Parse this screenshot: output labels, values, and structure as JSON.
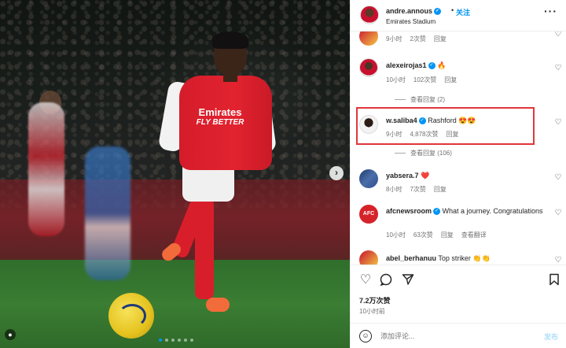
{
  "post": {
    "owner": "andre.annous",
    "follow_label": "关注",
    "separator": "•",
    "location": "Emirates Stadium",
    "more_icon": "more-horizontal-icon",
    "carousel_dots": 6,
    "active_dot": 0
  },
  "photo": {
    "sponsor_line1": "Emirates",
    "sponsor_line2": "FLY BETTER"
  },
  "comments": [
    {
      "user": "",
      "text": "",
      "time": "9小时",
      "likes": "2次赞",
      "reply": "回复"
    },
    {
      "user": "alexeirojas1",
      "verified": true,
      "text": "🔥",
      "time": "10小时",
      "likes": "102次赞",
      "reply": "回复",
      "view_replies": "查看回复 (2)"
    },
    {
      "user": "w.saliba4",
      "verified": true,
      "text": "Rashford 😍😍",
      "time": "9小时",
      "likes": "4,878次赞",
      "reply": "回复",
      "view_replies": "查看回复 (106)"
    },
    {
      "user": "yabsera.7",
      "verified": false,
      "text": "❤️",
      "time": "8小时",
      "likes": "7次赞",
      "reply": "回复"
    },
    {
      "user": "afcnewsroom",
      "verified": true,
      "text": "What a journey. Congratulations",
      "time": "10小时",
      "likes": "63次赞",
      "reply": "回复",
      "translate": "查看翻译",
      "avatar_text": "AFC"
    },
    {
      "user": "abel_berhanuu",
      "verified": false,
      "text": "Top striker 👏👏"
    }
  ],
  "actions": {
    "like_icon": "heart-icon",
    "comment_icon": "comment-icon",
    "share_icon": "share-icon",
    "save_icon": "bookmark-icon",
    "likes_count": "7.2万次赞",
    "time_ago": "10小时前"
  },
  "add_comment": {
    "placeholder": "添加评论...",
    "post_label": "发布"
  },
  "colors": {
    "link_blue": "#0095f6",
    "highlight_red": "#e0363a",
    "muted": "#737373"
  }
}
